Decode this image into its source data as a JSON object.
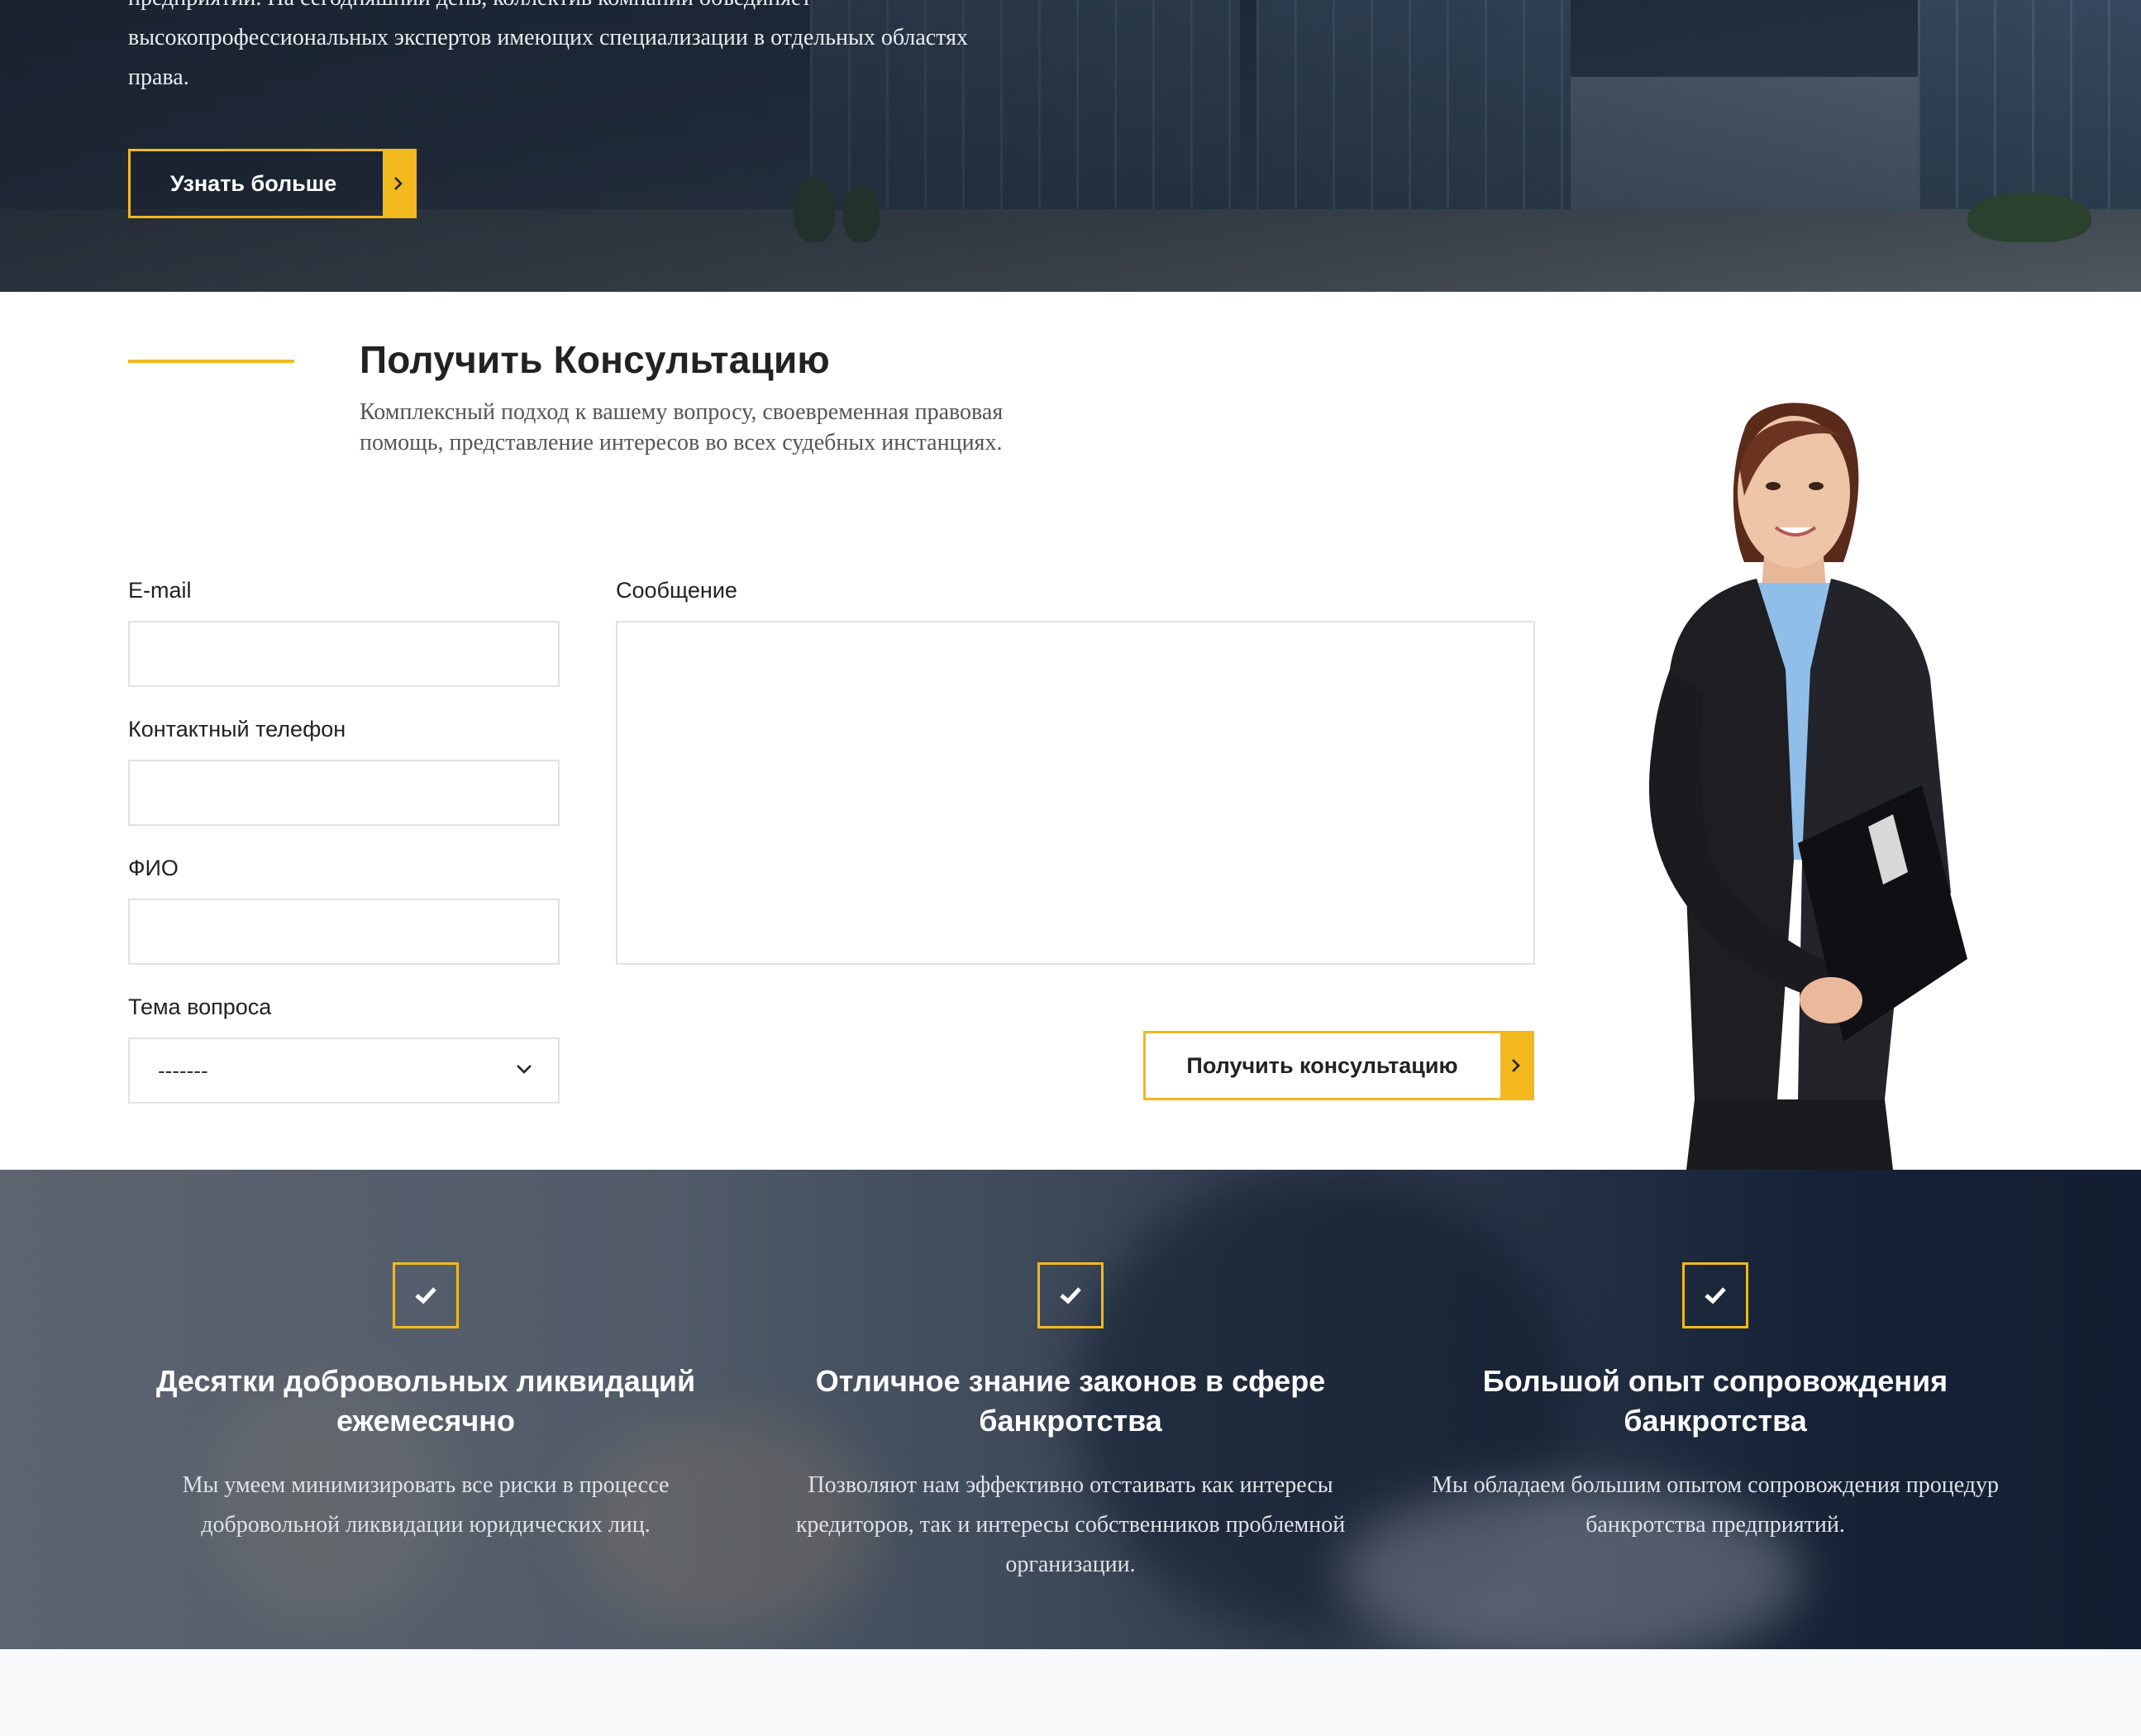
{
  "hero": {
    "text": "предприятий. На сегодняшний день, коллектив компании объединяет высокопрофессиональных экспертов имеющих специализации в отдельных областях права.",
    "button_label": "Узнать больше"
  },
  "consult": {
    "title": "Получить Консультацию",
    "description": "Комплексный подход к вашему вопросу, своевременная правовая помощь, представление интересов во всех судебных инстанциях.",
    "fields": {
      "email_label": "E-mail",
      "phone_label": "Контактный телефон",
      "name_label": "ФИО",
      "topic_label": "Тема вопроса",
      "topic_value": "-------",
      "message_label": "Сообщение"
    },
    "submit_label": "Получить консультацию"
  },
  "features": [
    {
      "title": "Десятки добровольных ликвидаций ежемесячно",
      "text": "Мы умеем минимизировать все риски в процессе добровольной ликвидации юридических лиц."
    },
    {
      "title": "Отличное знание законов в сфере банкротства",
      "text": "Позволяют нам эффективно отстаивать как интересы кредиторов, так и интересы собственников проблемной организации."
    },
    {
      "title": "Большой опыт сопровождения банкротства",
      "text": "Мы обладаем большим опытом сопровождения процедур банкротства предприятий."
    }
  ],
  "colors": {
    "accent": "#f2b81e",
    "text_dark": "#222222",
    "features_bg": "#1a2a40"
  },
  "icons": {
    "arrow": "chevron-right-icon",
    "select": "chevron-down-icon",
    "feature": "check-icon"
  }
}
